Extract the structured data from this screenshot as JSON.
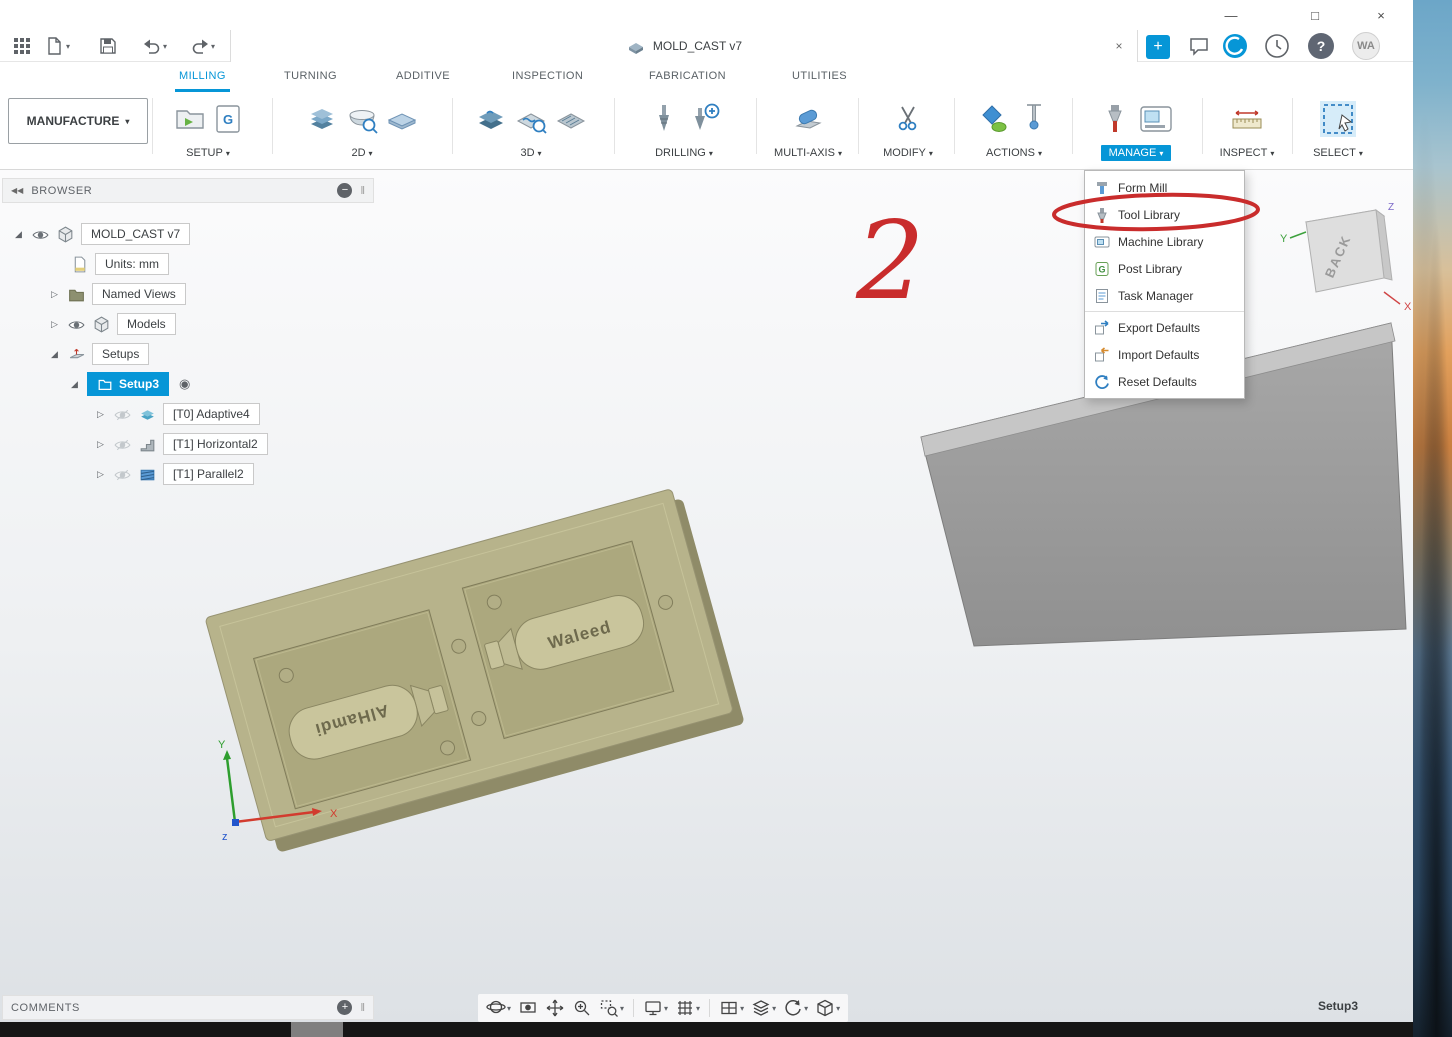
{
  "icons": {
    "caret_down": "▾",
    "close": "×",
    "add": "+",
    "minimize": "—",
    "maximize": "□",
    "help": "?",
    "collapse_left": "◀◀",
    "remove_circle": "−",
    "add_circle": "+",
    "radio_target": "◉",
    "expander_open": "◢",
    "expander_closed": "▷",
    "post_g": "G",
    "grip": "‖"
  },
  "appbar": {
    "document_tab": {
      "title": "MOLD_CAST v7"
    },
    "avatar": "WA"
  },
  "ribbon": {
    "workspace_button": "MANUFACTURE",
    "tabs": [
      {
        "label": "MILLING"
      },
      {
        "label": "TURNING"
      },
      {
        "label": "ADDITIVE"
      },
      {
        "label": "INSPECTION"
      },
      {
        "label": "FABRICATION"
      },
      {
        "label": "UTILITIES"
      }
    ],
    "groups": [
      {
        "label": "SETUP"
      },
      {
        "label": "2D"
      },
      {
        "label": "3D"
      },
      {
        "label": "DRILLING"
      },
      {
        "label": "MULTI-AXIS"
      },
      {
        "label": "MODIFY"
      },
      {
        "label": "ACTIONS"
      },
      {
        "label": "MANAGE"
      },
      {
        "label": "INSPECT"
      },
      {
        "label": "SELECT"
      }
    ]
  },
  "manage_menu": {
    "items": [
      {
        "label": "Form Mill"
      },
      {
        "label": "Tool Library"
      },
      {
        "label": "Machine Library"
      },
      {
        "label": "Post Library"
      },
      {
        "label": "Task Manager"
      },
      {
        "label": "Export Defaults"
      },
      {
        "label": "Import Defaults"
      },
      {
        "label": "Reset Defaults"
      }
    ]
  },
  "annotations": {
    "step_number": "2"
  },
  "browser": {
    "title": "BROWSER",
    "tree": {
      "root": "MOLD_CAST v7",
      "units": "Units: mm",
      "named_views": "Named Views",
      "models": "Models",
      "setups": "Setups",
      "setup3": "Setup3",
      "op1": "[T0] Adaptive4",
      "op2": "[T1] Horizontal2",
      "op3": "[T1] Parallel2"
    }
  },
  "viewport": {
    "viewcube": {
      "face": "BACK",
      "axis_x": "X",
      "axis_y": "Y",
      "axis_z": "Z"
    },
    "triad": {
      "x": "X",
      "y": "Y",
      "z": "z"
    },
    "mold_labels": {
      "left": "AlHamdi",
      "right": "Waleed"
    }
  },
  "footer": {
    "comments_label": "COMMENTS",
    "active_setup": "Setup3"
  },
  "colors": {
    "accent": "#0696d7",
    "annotation": "#c92c2c",
    "mold": "#b7b38b",
    "stock": "#9b9b9b"
  }
}
